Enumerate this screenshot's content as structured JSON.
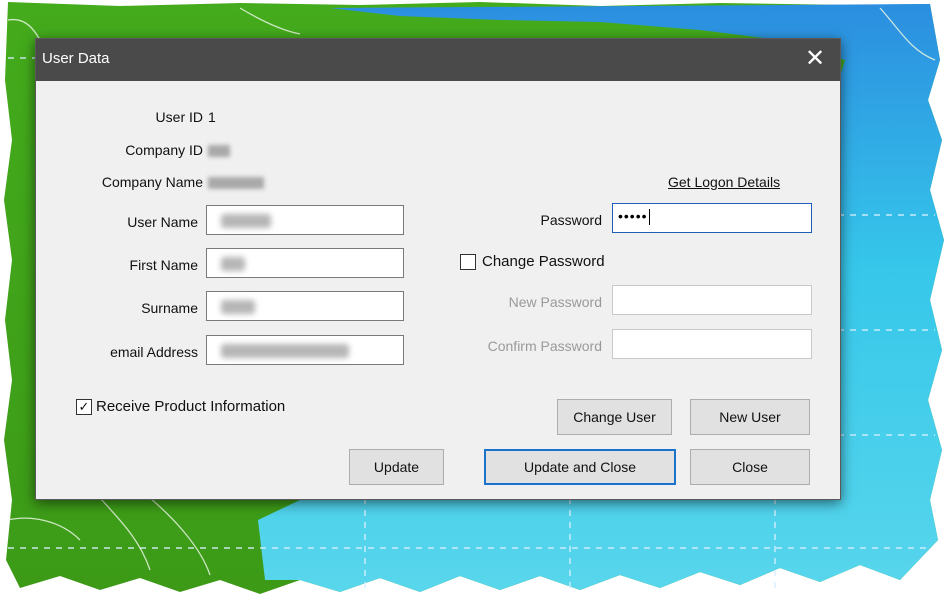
{
  "dialog": {
    "title": "User Data",
    "close_glyph": "✕",
    "close_icon": "close-icon"
  },
  "fields": {
    "user_id": {
      "label": "User ID",
      "value": "1"
    },
    "company_id": {
      "label": "Company ID"
    },
    "company_name": {
      "label": "Company Name"
    },
    "user_name": {
      "label": "User Name"
    },
    "first_name": {
      "label": "First Name"
    },
    "surname": {
      "label": "Surname"
    },
    "email": {
      "label": "email Address"
    },
    "password": {
      "label": "Password",
      "value": "•••••"
    },
    "new_password": {
      "label": "New Password",
      "value": ""
    },
    "confirm_password": {
      "label": "Confirm Password",
      "value": ""
    }
  },
  "links": {
    "get_logon_details": "Get Logon Details"
  },
  "checkboxes": {
    "change_password": {
      "label": "Change Password",
      "checked": false,
      "mark": ""
    },
    "receive_product_info": {
      "label": "Receive Product Information",
      "checked": true,
      "mark": "✓"
    }
  },
  "buttons": {
    "change_user": "Change User",
    "new_user": "New User",
    "update": "Update",
    "update_and_close": "Update and Close",
    "close": "Close"
  },
  "colors": {
    "titlebar": "#4a4a4a",
    "dialog_bg": "#f0f0f0",
    "map_green": "#3fa51a",
    "map_water": "#35c6e6",
    "focus_accent": "#1a73c9"
  }
}
